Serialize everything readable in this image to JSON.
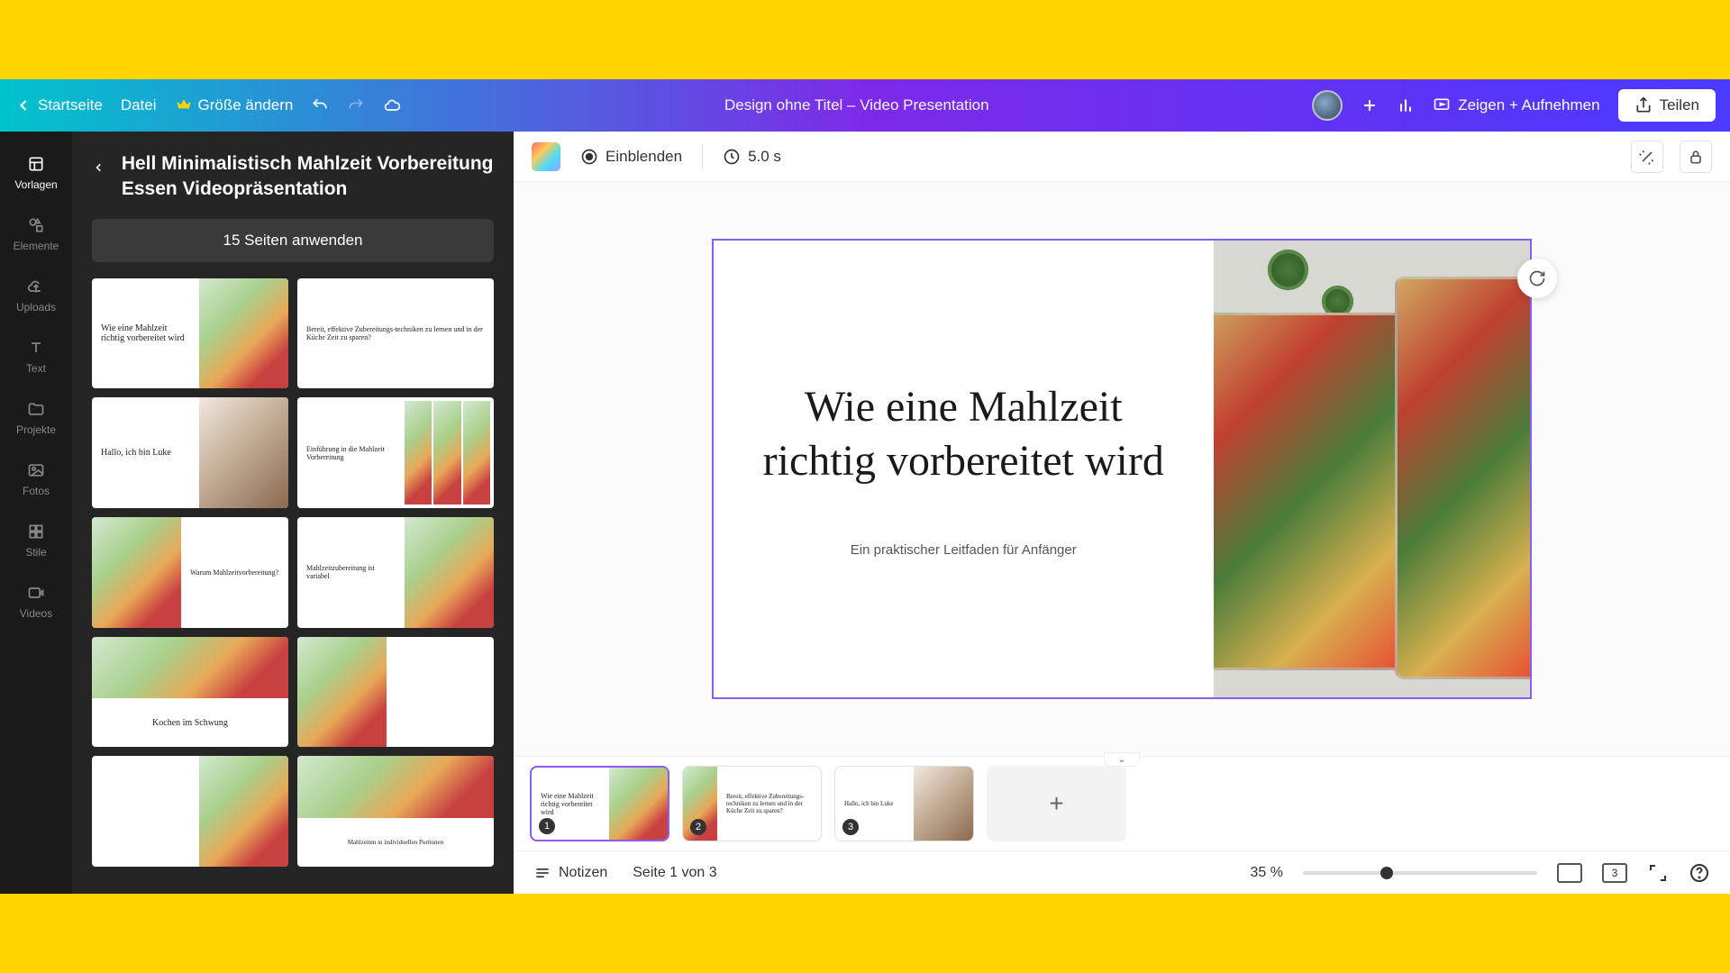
{
  "topbar": {
    "home": "Startseite",
    "file": "Datei",
    "resize": "Größe ändern",
    "doc_title": "Design ohne Titel – Video Presentation",
    "present": "Zeigen + Aufnehmen",
    "share": "Teilen"
  },
  "rail": {
    "templates": "Vorlagen",
    "elements": "Elemente",
    "uploads": "Uploads",
    "text": "Text",
    "projects": "Projekte",
    "photos": "Fotos",
    "styles": "Stile",
    "videos": "Videos"
  },
  "panel": {
    "title": "Hell Minimalistisch Mahlzeit Vorbereitung Essen Videopräsentation",
    "apply": "15 Seiten anwenden",
    "t1": "Wie eine Mahlzeit richtig vorbereitet wird",
    "t2": "Bereit, effektive Zubereitungs-techniken zu lernen und in der Küche Zeit zu sparen?",
    "t3": "Hallo, ich bin Luke",
    "t4": "Einführung in die Mahlzeit Vorbereitung",
    "t5": "Warum Mahlzeitvorbereitung?",
    "t6": "Mahlzeitzubereitung ist variabel",
    "t7": "Kochen im Schwung",
    "t8": "Mahlzeiten in individuellen Portionen"
  },
  "ctx": {
    "transition": "Einblenden",
    "duration": "5.0 s"
  },
  "slide": {
    "headline": "Wie eine Mahlzeit richtig vorbereitet wird",
    "subtitle": "Ein praktischer Leitfaden für Anfänger"
  },
  "timeline": {
    "t1": "Wie eine Mahlzeit richtig vorbereitet wird",
    "t2": "Bereit, effektive Zubereitungs-techniken zu lernen und in der Küche Zeit zu sparen?",
    "t3": "Hallo, ich bin Luke",
    "b1": "1",
    "b2": "2",
    "b3": "3"
  },
  "status": {
    "notes": "Notizen",
    "page": "Seite 1 von 3",
    "zoom": "35 %",
    "count": "3"
  }
}
